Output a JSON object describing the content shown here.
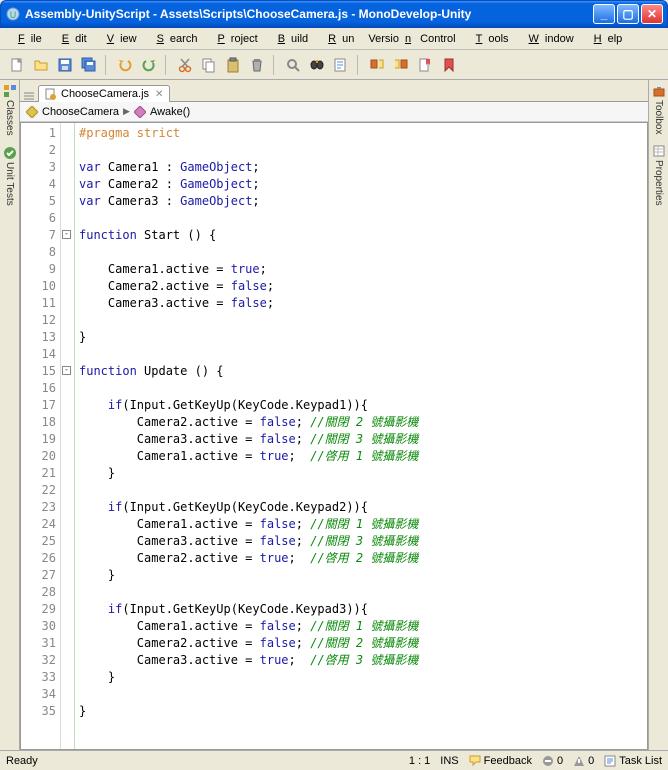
{
  "title": "Assembly-UnityScript - Assets\\Scripts\\ChooseCamera.js - MonoDevelop-Unity",
  "menu": [
    {
      "label": "File",
      "ul": "F"
    },
    {
      "label": "Edit",
      "ul": "E"
    },
    {
      "label": "View",
      "ul": "V"
    },
    {
      "label": "Search",
      "ul": "S"
    },
    {
      "label": "Project",
      "ul": "P"
    },
    {
      "label": "Build",
      "ul": "B"
    },
    {
      "label": "Run",
      "ul": "R"
    },
    {
      "label": "Version Control",
      "ul": "n"
    },
    {
      "label": "Tools",
      "ul": "T"
    },
    {
      "label": "Window",
      "ul": "W"
    },
    {
      "label": "Help",
      "ul": "H"
    }
  ],
  "tab": {
    "name": "ChooseCamera.js"
  },
  "breadcrumb": {
    "class": "ChooseCamera",
    "method": "Awake()"
  },
  "left_panels": [
    "Classes",
    "Unit Tests"
  ],
  "right_panels": [
    "Toolbox",
    "Properties"
  ],
  "cursor": "1 : 1",
  "mode": "INS",
  "feedback": "Feedback",
  "err_count": "0",
  "warn_count": "0",
  "tasklist": "Task List",
  "status": "Ready",
  "code_lines": [
    {
      "n": 1,
      "fold": "",
      "html": "<span class='pragma'>#pragma strict</span>"
    },
    {
      "n": 2,
      "fold": "",
      "html": ""
    },
    {
      "n": 3,
      "fold": "",
      "html": "<span class='kw'>var</span> Camera1 : <span class='type'>GameObject</span>;"
    },
    {
      "n": 4,
      "fold": "",
      "html": "<span class='kw'>var</span> Camera2 : <span class='type'>GameObject</span>;"
    },
    {
      "n": 5,
      "fold": "",
      "html": "<span class='kw'>var</span> Camera3 : <span class='type'>GameObject</span>;"
    },
    {
      "n": 6,
      "fold": "",
      "html": ""
    },
    {
      "n": 7,
      "fold": "box",
      "html": "<span class='kw'>function</span> Start () {"
    },
    {
      "n": 8,
      "fold": "",
      "html": ""
    },
    {
      "n": 9,
      "fold": "",
      "html": "    Camera1.active = <span class='bool'>true</span>;"
    },
    {
      "n": 10,
      "fold": "",
      "html": "    Camera2.active = <span class='bool'>false</span>;"
    },
    {
      "n": 11,
      "fold": "",
      "html": "    Camera3.active = <span class='bool'>false</span>;"
    },
    {
      "n": 12,
      "fold": "",
      "html": ""
    },
    {
      "n": 13,
      "fold": "",
      "html": "}"
    },
    {
      "n": 14,
      "fold": "",
      "html": ""
    },
    {
      "n": 15,
      "fold": "box",
      "html": "<span class='kw'>function</span> Update () {"
    },
    {
      "n": 16,
      "fold": "",
      "html": ""
    },
    {
      "n": 17,
      "fold": "",
      "html": "    <span class='kw'>if</span>(Input.GetKeyUp(KeyCode.Keypad1)){"
    },
    {
      "n": 18,
      "fold": "",
      "html": "        Camera2.active = <span class='bool'>false</span>; <span class='comment'>//關閉 2 號攝影機</span>"
    },
    {
      "n": 19,
      "fold": "",
      "html": "        Camera3.active = <span class='bool'>false</span>; <span class='comment'>//關閉 3 號攝影機</span>"
    },
    {
      "n": 20,
      "fold": "",
      "html": "        Camera1.active = <span class='bool'>true</span>;  <span class='comment'>//啓用 1 號攝影機</span>"
    },
    {
      "n": 21,
      "fold": "",
      "html": "    }"
    },
    {
      "n": 22,
      "fold": "",
      "html": ""
    },
    {
      "n": 23,
      "fold": "",
      "html": "    <span class='kw'>if</span>(Input.GetKeyUp(KeyCode.Keypad2)){"
    },
    {
      "n": 24,
      "fold": "",
      "html": "        Camera1.active = <span class='bool'>false</span>; <span class='comment'>//關閉 1 號攝影機</span>"
    },
    {
      "n": 25,
      "fold": "",
      "html": "        Camera3.active = <span class='bool'>false</span>; <span class='comment'>//關閉 3 號攝影機</span>"
    },
    {
      "n": 26,
      "fold": "",
      "html": "        Camera2.active = <span class='bool'>true</span>;  <span class='comment'>//啓用 2 號攝影機</span>"
    },
    {
      "n": 27,
      "fold": "",
      "html": "    }"
    },
    {
      "n": 28,
      "fold": "",
      "html": ""
    },
    {
      "n": 29,
      "fold": "",
      "html": "    <span class='kw'>if</span>(Input.GetKeyUp(KeyCode.Keypad3)){"
    },
    {
      "n": 30,
      "fold": "",
      "html": "        Camera1.active = <span class='bool'>false</span>; <span class='comment'>//關閉 1 號攝影機</span>"
    },
    {
      "n": 31,
      "fold": "",
      "html": "        Camera2.active = <span class='bool'>false</span>; <span class='comment'>//關閉 2 號攝影機</span>"
    },
    {
      "n": 32,
      "fold": "",
      "html": "        Camera3.active = <span class='bool'>true</span>;  <span class='comment'>//啓用 3 號攝影機</span>"
    },
    {
      "n": 33,
      "fold": "",
      "html": "    }"
    },
    {
      "n": 34,
      "fold": "",
      "html": ""
    },
    {
      "n": 35,
      "fold": "",
      "html": "}"
    }
  ]
}
